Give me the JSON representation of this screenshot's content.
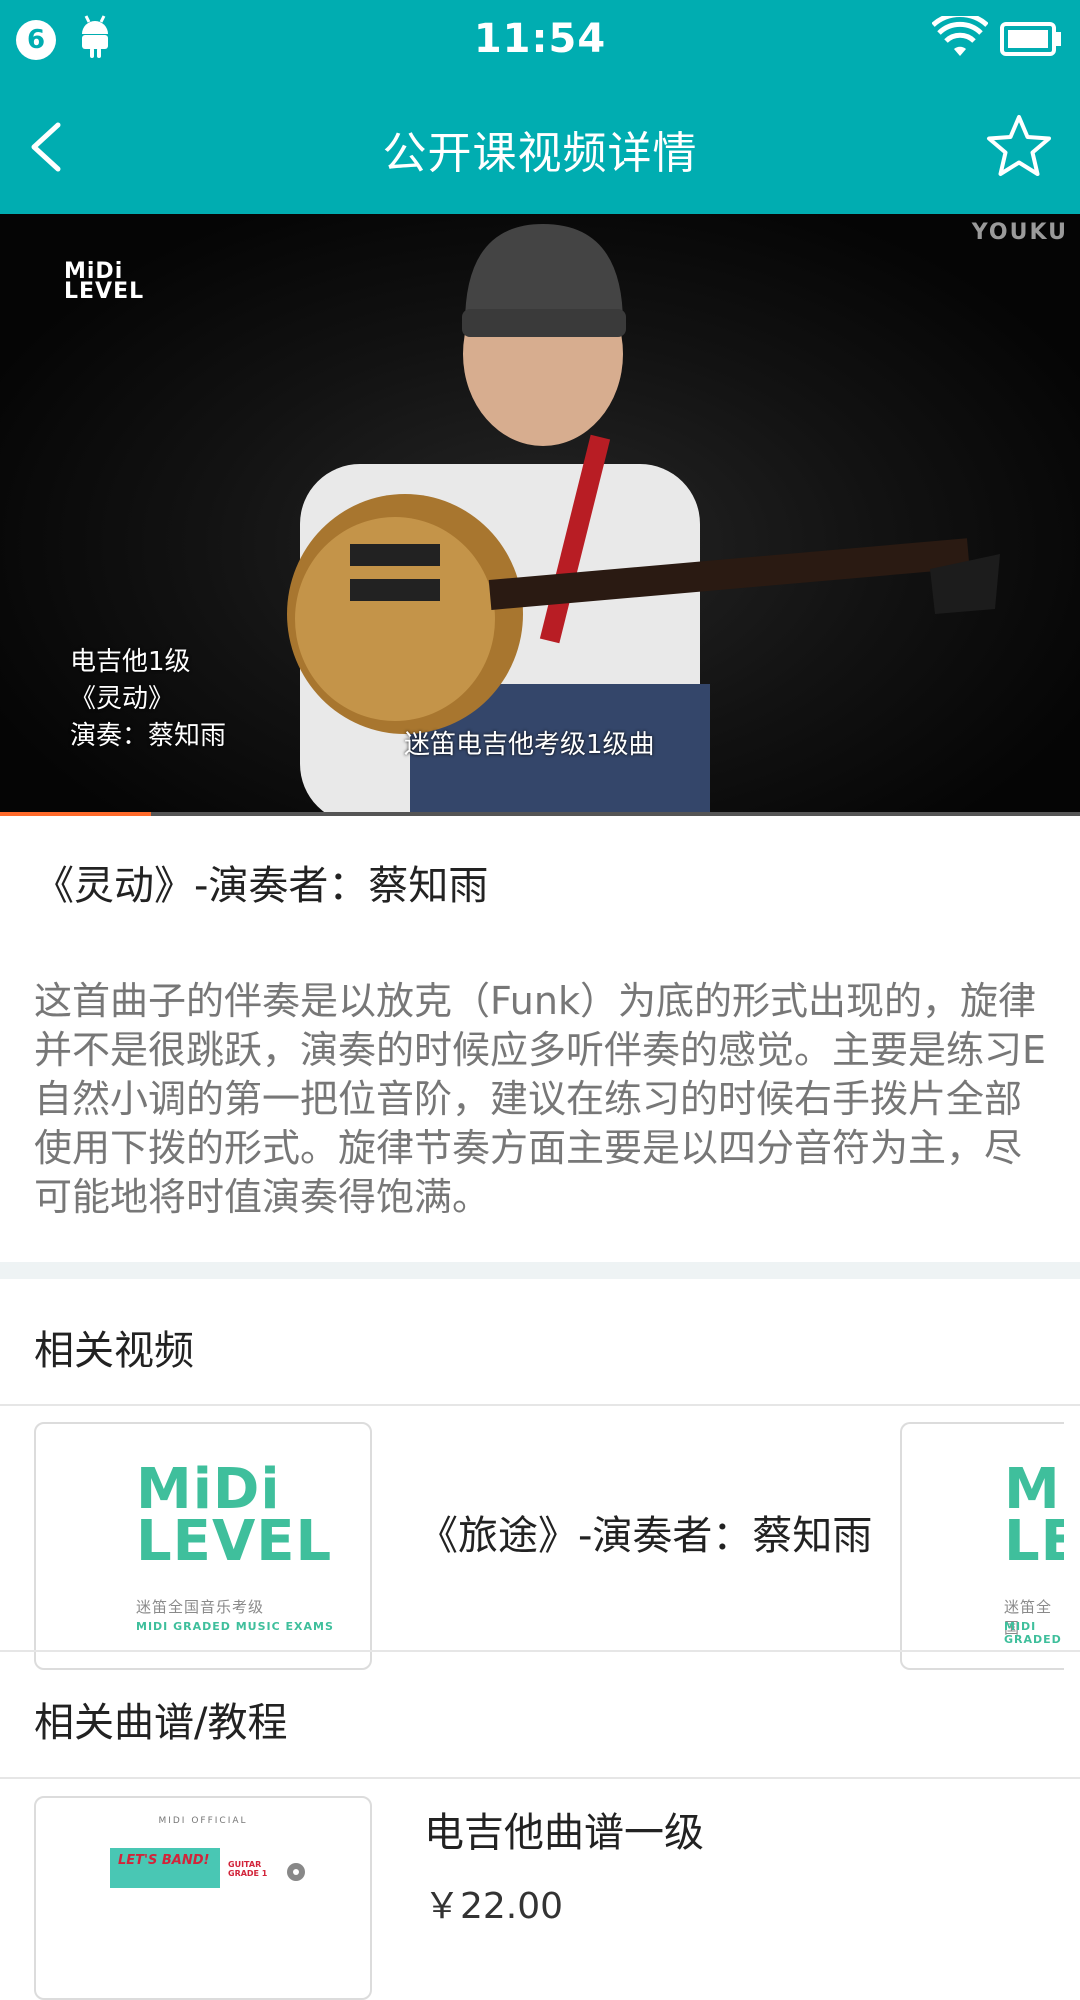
{
  "status_bar": {
    "notification_count": "6",
    "time": "11:54"
  },
  "app_bar": {
    "title": "公开课视频详情"
  },
  "video": {
    "watermark": "YOUKU",
    "logo_text_line1": "MiDi",
    "logo_text_line2": "LEVEL",
    "caption_line1": "电吉他1级",
    "caption_line2": "《灵动》",
    "caption_line3": "演奏：蔡知雨",
    "subtitle": "迷笛电吉他考级1级曲",
    "progress": 0.14
  },
  "detail": {
    "title": "《灵动》-演奏者：蔡知雨",
    "description": "这首曲子的伴奏是以放克（Funk）为底的形式出现的，旋律并不是很跳跃，演奏的时候应多听伴奏的感觉。主要是练习E自然小调的第一把位音阶，建议在练习的时候右手拨片全部使用下拨的形式。旋律节奏方面主要是以四分音符为主，尽可能地将时值演奏得饱满。"
  },
  "related_videos": {
    "section_title": "相关视频",
    "items": [
      {
        "name": "《旅途》-演奏者：蔡知雨",
        "logo_line1": "MiDi",
        "logo_line2": "LEVEL",
        "logo_sub1": "迷笛全国音乐考级",
        "logo_sub2": "MIDI GRADED MUSIC EXAMS"
      },
      {
        "logo_line1": "MiDi",
        "logo_line2": "LEVEL",
        "logo_sub1": "迷笛全国",
        "logo_sub2": "MIDI GRADED"
      }
    ]
  },
  "related_tutorials": {
    "section_title": "相关曲谱/教程",
    "items": [
      {
        "name": "电吉他曲谱一级",
        "price": "￥22.00",
        "cover_top": "MIDI OFFICIAL",
        "cover_banner": "LET'S BAND!",
        "cover_grade": "GUITAR GRADE 1"
      }
    ]
  },
  "colors": {
    "primary": "#00adb1",
    "brand_green": "#3fbf9c",
    "progress": "#ff6a2a"
  }
}
